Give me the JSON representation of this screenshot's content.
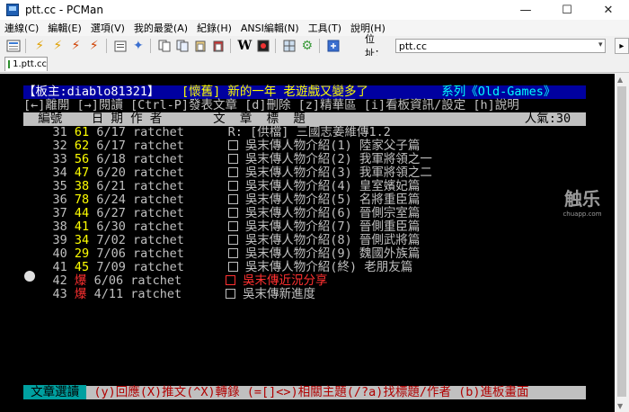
{
  "window": {
    "title": "ptt.cc - PCMan",
    "min": "—",
    "max": "☐",
    "close": "✕"
  },
  "menu": [
    "連線(C)",
    "編輯(E)",
    "選項(V)",
    "我的最愛(A)",
    "紀錄(H)",
    "ANSI編輯(N)",
    "工具(T)",
    "說明(H)"
  ],
  "toolbar": {
    "address_label": "位址：",
    "address_value": "ptt.cc",
    "go_label": "▸"
  },
  "tabs": [
    {
      "label": "1.ptt.cc"
    }
  ],
  "board": {
    "header_left": "【板主:diablo81321】",
    "header_mid": "[懷舊] 新的一年 老遊戲又變多了",
    "header_right": "系列《Old-Games》",
    "help": "[←]離開 [→]閱讀 [Ctrl-P]發表文章 [d]刪除 [z]精華區 [i]看板資訊/設定 [h]說明",
    "col_num": "編號",
    "col_date": "日 期",
    "col_author": "作 者",
    "col_title": "文  章  標  題",
    "popularity": "人氣:30"
  },
  "posts": [
    {
      "num": "31",
      "count": "61",
      "date": "6/17",
      "author": "ratchet",
      "mark": "R:",
      "title": "[供檔] 三國志姜維傳1.2"
    },
    {
      "num": "32",
      "count": "62",
      "date": "6/17",
      "author": "ratchet",
      "mark": "□",
      "title": "吳末傳人物介紹(1) 陸家父子篇"
    },
    {
      "num": "33",
      "count": "56",
      "date": "6/18",
      "author": "ratchet",
      "mark": "□",
      "title": "吳末傳人物介紹(2) 我軍將領之一"
    },
    {
      "num": "34",
      "count": "47",
      "date": "6/20",
      "author": "ratchet",
      "mark": "□",
      "title": "吳末傳人物介紹(3) 我軍將領之二"
    },
    {
      "num": "35",
      "count": "38",
      "date": "6/21",
      "author": "ratchet",
      "mark": "□",
      "title": "吳末傳人物介紹(4) 皇室嬪妃篇"
    },
    {
      "num": "36",
      "count": "78",
      "date": "6/24",
      "author": "ratchet",
      "mark": "□",
      "title": "吳末傳人物介紹(5) 名將重臣篇"
    },
    {
      "num": "37",
      "count": "44",
      "date": "6/27",
      "author": "ratchet",
      "mark": "□",
      "title": "吳末傳人物介紹(6) 晉側宗室篇"
    },
    {
      "num": "38",
      "count": "41",
      "date": "6/30",
      "author": "ratchet",
      "mark": "□",
      "title": "吳末傳人物介紹(7) 晉側重臣篇"
    },
    {
      "num": "39",
      "count": "34",
      "date": "7/02",
      "author": "ratchet",
      "mark": "□",
      "title": "吳末傳人物介紹(8) 晉側武將篇"
    },
    {
      "num": "40",
      "count": "29",
      "date": "7/06",
      "author": "ratchet",
      "mark": "□",
      "title": "吳末傳人物介紹(9) 魏國外族篇"
    },
    {
      "num": "41",
      "count": "45",
      "date": "7/09",
      "author": "ratchet",
      "mark": "□",
      "title": "吳末傳人物介紹(終) 老朋友篇"
    },
    {
      "num": "42",
      "count": "爆",
      "date": "6/06",
      "author": "ratchet",
      "mark": "□",
      "title": "吳末傳近況分享"
    },
    {
      "num": "43",
      "count": "爆",
      "date": "4/11",
      "author": "ratchet",
      "mark": "□",
      "title": "吳末傳新進度"
    }
  ],
  "footer": {
    "tag": " 文章選讀 ",
    "text": " (y)回應(X)推文(^X)轉錄 (=[]<>)相關主題(/?a)找標題/作者 (b)進板畫面"
  },
  "watermark": {
    "big": "触乐",
    "small": "chuapp.com"
  },
  "colors": {
    "terminal_bg": "#000000",
    "header_bg": "#0000a0",
    "bar_gray": "#c0c0c0",
    "hot_red": "#ff3030",
    "count_yellow": "#ffff00"
  }
}
